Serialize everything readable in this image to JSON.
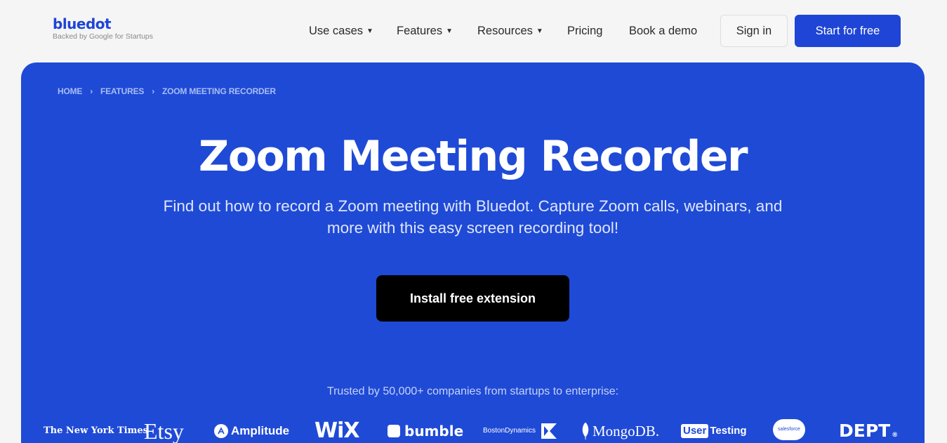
{
  "brand": {
    "name": "bluedot",
    "tagline": "Backed by Google for Startups"
  },
  "nav": {
    "items": [
      {
        "label": "Use cases",
        "has_caret": true
      },
      {
        "label": "Features",
        "has_caret": true
      },
      {
        "label": "Resources",
        "has_caret": true
      },
      {
        "label": "Pricing",
        "has_caret": false
      },
      {
        "label": "Book a demo",
        "has_caret": false
      }
    ],
    "caret": "▼",
    "sign_in": "Sign in",
    "start": "Start for free"
  },
  "breadcrumb": {
    "items": [
      "HOME",
      "FEATURES",
      "ZOOM MEETING RECORDER"
    ],
    "separator": "›"
  },
  "hero": {
    "title": "Zoom Meeting Recorder",
    "subtitle": "Find out how to record a Zoom meeting with Bluedot. Capture Zoom calls, webinars, and more with this easy screen recording tool!",
    "cta": "Install free extension",
    "trusted": "Trusted by 50,000+ companies from startups to enterprise:"
  },
  "logos": {
    "nyt": "The New York Times",
    "etsy": "Etsy",
    "amplitude": "Amplitude",
    "wix": "WiX",
    "bumble": "bumble",
    "boston_dynamics": "BostonDynamics",
    "mongodb": "MongoDB.",
    "usertesting_box": "User",
    "usertesting_text": "Testing",
    "salesforce": "salesforce",
    "dept": "DEPT",
    "dept_reg": "®"
  },
  "colors": {
    "brand_blue": "#1f45d6",
    "hero_blue": "#1f4ad6",
    "cta_black": "#000000"
  }
}
